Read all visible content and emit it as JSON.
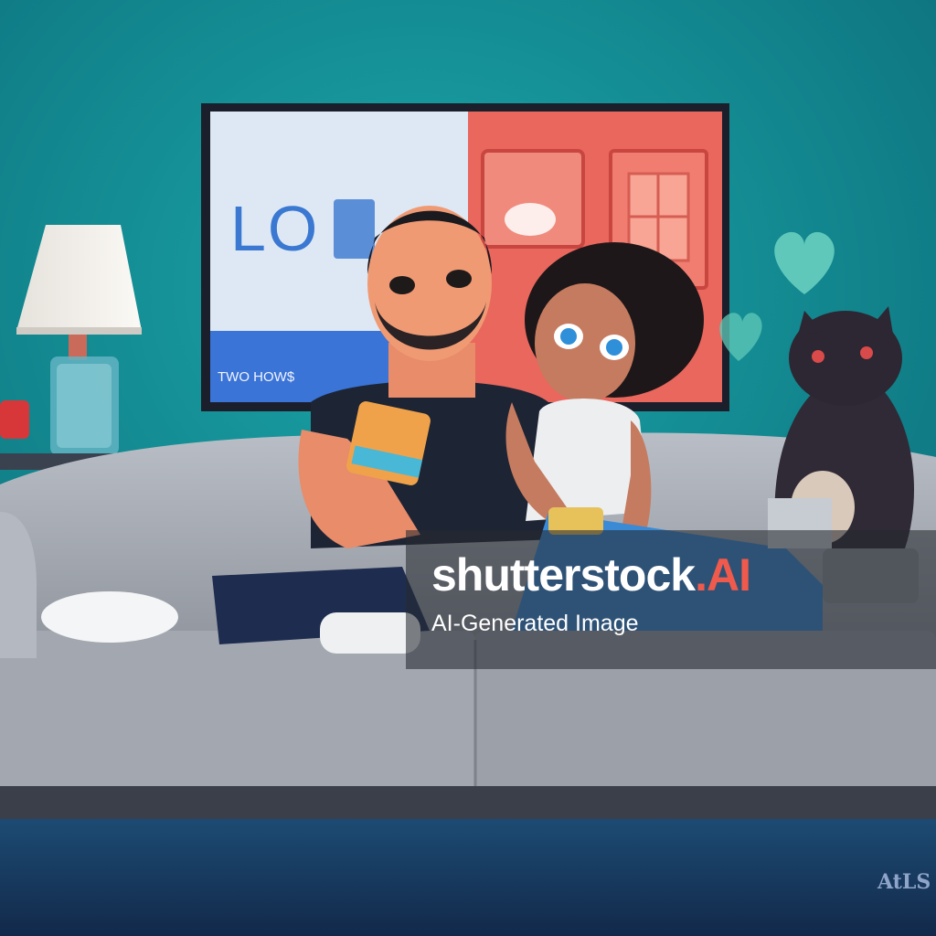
{
  "tv": {
    "screen_text": "LO",
    "bottom_text": "TWO HOW$"
  },
  "watermark": {
    "brand": "shutterstock",
    "ai_mark": ".AI",
    "caption": "AI-Generated Image"
  },
  "signature": "AtLS",
  "colors": {
    "wall": "#137f86",
    "floor": "#1c3f66",
    "sofa": "#a9aeb6",
    "tv_left": "#d8e5f2",
    "tv_right": "#e9675d",
    "accent": "#f05a4c"
  }
}
